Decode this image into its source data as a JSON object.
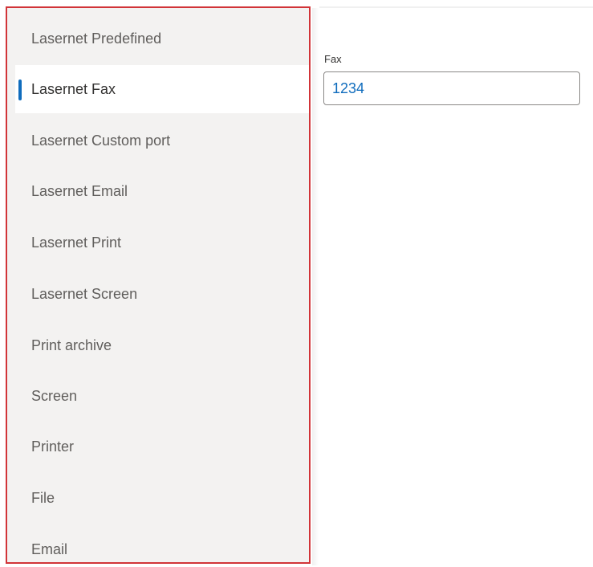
{
  "nav": {
    "items": [
      {
        "label": "Lasernet Predefined",
        "selected": false
      },
      {
        "label": "Lasernet Fax",
        "selected": true
      },
      {
        "label": "Lasernet Custom port",
        "selected": false
      },
      {
        "label": "Lasernet Email",
        "selected": false
      },
      {
        "label": "Lasernet Print",
        "selected": false
      },
      {
        "label": "Lasernet Screen",
        "selected": false
      },
      {
        "label": "Print archive",
        "selected": false
      },
      {
        "label": "Screen",
        "selected": false
      },
      {
        "label": "Printer",
        "selected": false
      },
      {
        "label": "File",
        "selected": false
      },
      {
        "label": "Email",
        "selected": false
      }
    ]
  },
  "fax_field": {
    "label": "Fax",
    "value": "1234"
  },
  "colors": {
    "highlight_border": "#d13438",
    "selection_accent": "#0f6cbd",
    "nav_background": "#f3f2f1"
  }
}
